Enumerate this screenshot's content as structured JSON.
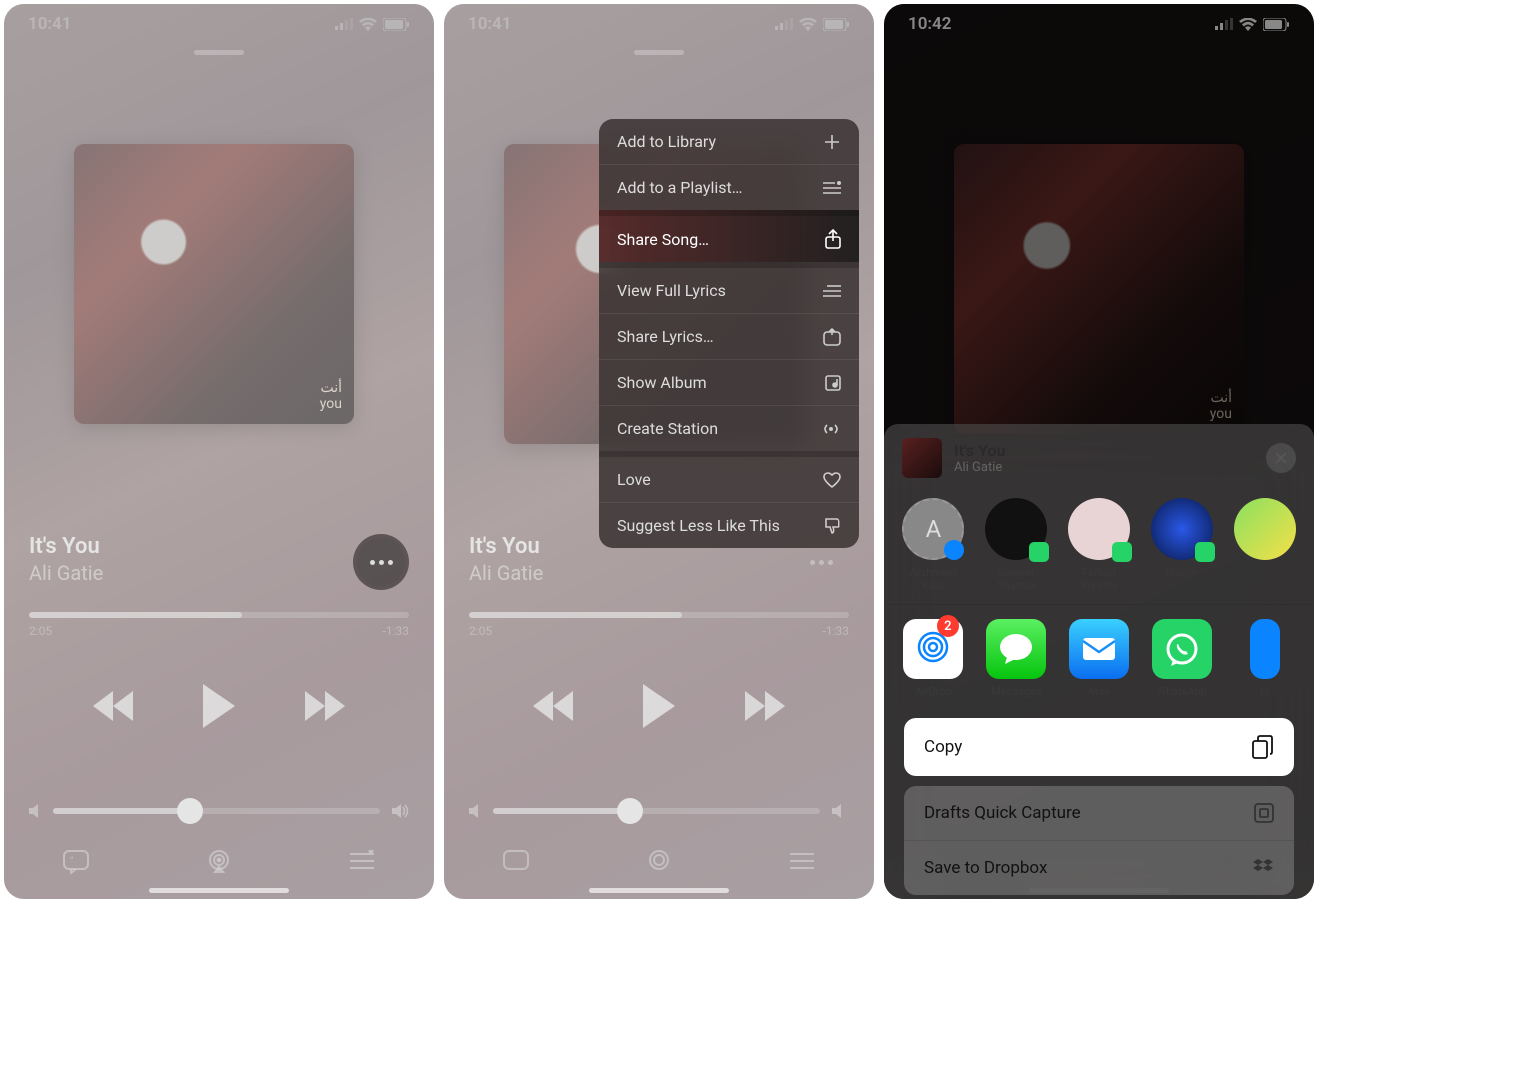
{
  "panel1": {
    "status_time": "10:41",
    "song_title": "It's You",
    "song_artist": "Ali Gatie",
    "time_elapsed": "2:05",
    "time_remaining": "-1:33",
    "album_label_line1": "أنت",
    "album_label_line2": "you"
  },
  "panel2": {
    "status_time": "10:41",
    "song_title": "It's You",
    "song_artist": "Ali Gatie",
    "time_elapsed": "2:05",
    "time_remaining": "-1:33",
    "menu": {
      "add_library": "Add to Library",
      "add_playlist": "Add to a Playlist…",
      "share_song": "Share Song…",
      "view_lyrics": "View Full Lyrics",
      "share_lyrics": "Share Lyrics…",
      "show_album": "Show Album",
      "create_station": "Create Station",
      "love": "Love",
      "suggest_less": "Suggest Less Like This"
    }
  },
  "panel3": {
    "status_time": "10:42",
    "share": {
      "title": "It's You",
      "artist": "Ali Gatie",
      "contacts": {
        "c1": "Arshmeet Kaur",
        "c2": "Sameer Sharma",
        "c3": "Farhan Kureshi",
        "c4": "Bhavin"
      },
      "apps": {
        "airdrop": "AirDrop",
        "messages": "Messages",
        "mail": "Mail",
        "whatsapp": "WhatsApp",
        "airdrop_badge": "2"
      },
      "actions": {
        "copy": "Copy",
        "drafts": "Drafts Quick Capture",
        "dropbox": "Save to Dropbox"
      }
    },
    "album_label_line1": "أنت",
    "album_label_line2": "you"
  }
}
